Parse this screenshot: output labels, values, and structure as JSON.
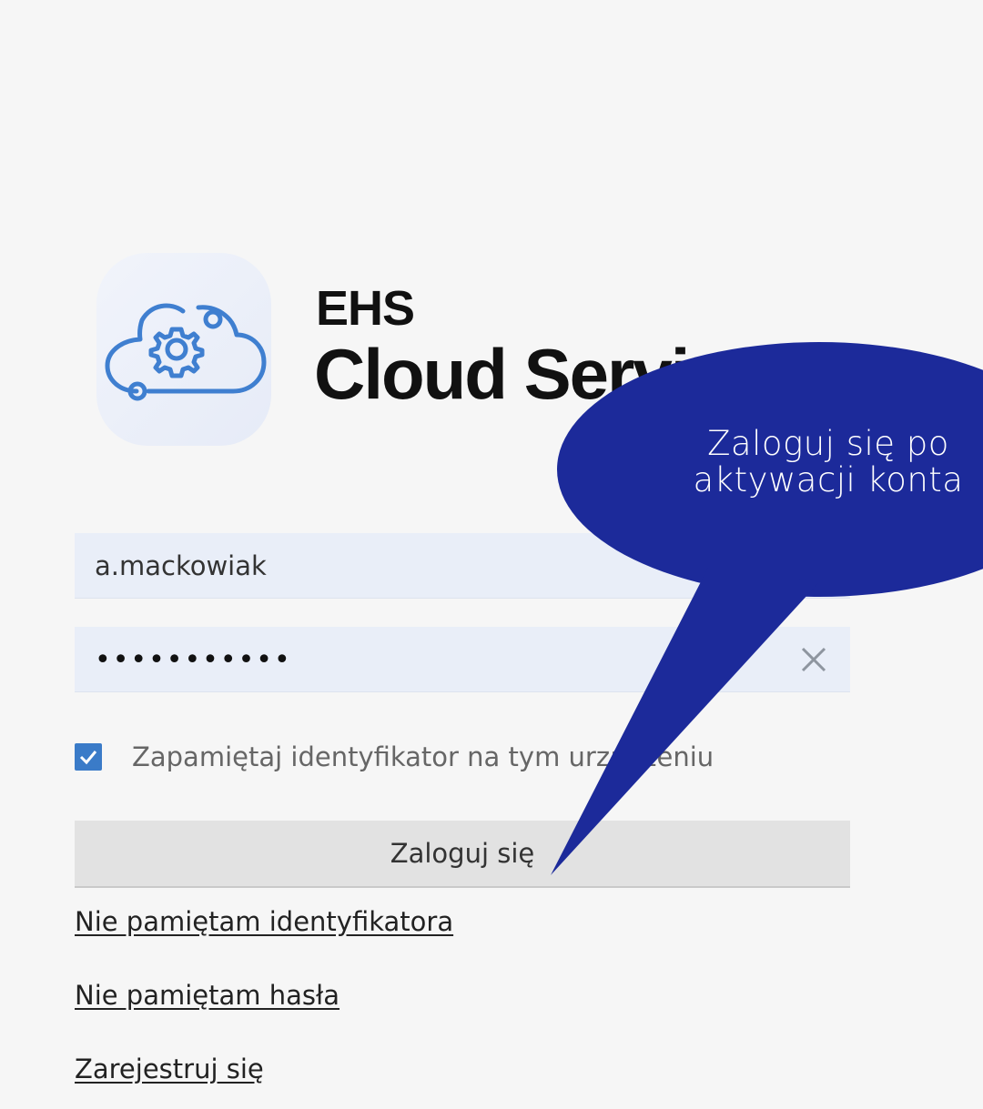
{
  "brand": {
    "line1": "EHS",
    "line2": "Cloud Service"
  },
  "login_form": {
    "username_value": "a.mackowiak",
    "password_value": "•••••••••••",
    "remember_label": "Zapamiętaj identyfikator na tym urządzeniu",
    "remember_checked": true,
    "login_button": "Zaloguj się",
    "links": {
      "forgot_id": "Nie pamiętam identyfikatora",
      "forgot_password": "Nie pamiętam hasła",
      "register": "Zarejestruj się"
    }
  },
  "callout": {
    "line1": "Zaloguj się po",
    "line2": "aktywacji konta",
    "color": "#1c2a9a"
  },
  "colors": {
    "accent": "#3a7bc8",
    "field_bg": "#e9eef8",
    "page_bg": "#f6f6f6"
  },
  "icons": {
    "logo": "cloud-gear-icon",
    "clear": "close-icon",
    "check": "check-icon"
  }
}
